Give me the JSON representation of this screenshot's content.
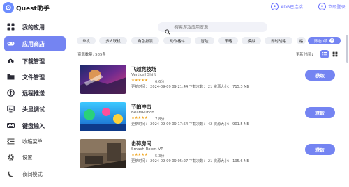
{
  "app": {
    "title": "Quest助手",
    "adb_status": "ADB已连接",
    "login": "立即登录"
  },
  "sidebar": {
    "items": [
      {
        "label": "我的应用",
        "icon": "grid-icon"
      },
      {
        "label": "应用商店",
        "icon": "gamepad-icon"
      },
      {
        "label": "下载管理",
        "icon": "cloud-download-icon"
      },
      {
        "label": "文件管理",
        "icon": "folder-icon"
      },
      {
        "label": "远程推送",
        "icon": "push-icon"
      },
      {
        "label": "头显调试",
        "icon": "debug-icon"
      },
      {
        "label": "键盘输入",
        "icon": "keyboard-icon"
      },
      {
        "label": "收缩菜单",
        "icon": "collapse-icon"
      },
      {
        "label": "设置",
        "icon": "gear-icon"
      },
      {
        "label": "夜间模式",
        "icon": "moon-icon"
      }
    ]
  },
  "search": {
    "placeholder": "搜索游戏应用资源"
  },
  "filters": {
    "chips": [
      "单机",
      "多人联机",
      "角色扮演",
      "动作格斗",
      "冒险",
      "策略",
      "模拟",
      "即时战略",
      "格"
    ],
    "active_label": "筛选0项"
  },
  "list": {
    "count_label": "资源数量: 585条",
    "sort_label": "更新时间↓",
    "get_label": "获取",
    "games": [
      {
        "title": "飞越竞技场",
        "subtitle": "Vertical Shift",
        "stars": "★★★★★",
        "rating": "6.6分",
        "meta": "更新时间：  2024-09-09 09:21:44    下载次数：  21    资源大小：  715.3 MB"
      },
      {
        "title": "节拍冲击",
        "subtitle": "BeatsPunch",
        "stars": "★★★★★",
        "rating": "7.8分",
        "meta": "更新时间：  2024-09-09 09:17:54    下载次数：  42    资源大小：  901.5 MB"
      },
      {
        "title": "击碎房间",
        "subtitle": "Smash Room VR",
        "stars": "★★★★★",
        "rating": "5.3分",
        "meta": "更新时间：  2024-09-09 09:05:27    下载次数：  21    资源大小：  195.6 MB"
      }
    ]
  },
  "colors": {
    "accent": "#7484f2",
    "star": "#f0a92a",
    "link": "#6b72ff"
  }
}
